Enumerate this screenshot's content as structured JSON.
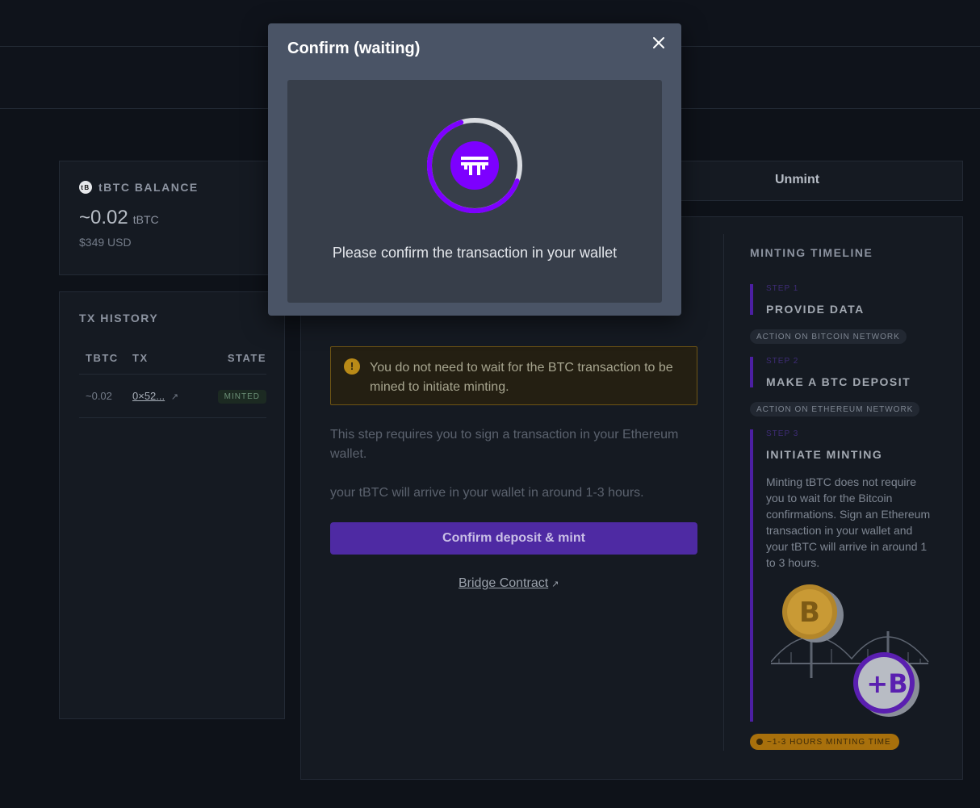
{
  "balance": {
    "title": "tBTC BALANCE",
    "token_icon": "tbtc-token-icon",
    "token_glyph": "tB",
    "amount": "~0.02",
    "unit": "tBTC",
    "usd": "$349 USD"
  },
  "history": {
    "title": "TX HISTORY",
    "columns": [
      "TBTC",
      "TX",
      "STATE"
    ],
    "rows": [
      {
        "amount": "~0.02",
        "tx": "0×52...",
        "state": "MINTED"
      }
    ]
  },
  "tabs": {
    "unmint": "Unmint"
  },
  "form": {
    "alert_icon": "!",
    "alert": "You do not need to wait for the BTC transaction to be mined to initiate minting.",
    "step_text": "This step requires you to sign a transaction in your Ethereum wallet.",
    "eta_text": "your tBTC will arrive in your wallet in around 1-3 hours.",
    "cta": "Confirm deposit & mint",
    "bridge_link": "Bridge Contract"
  },
  "timeline": {
    "title": "MINTING TIMELINE",
    "steps": [
      {
        "label": "STEP 1",
        "title": "PROVIDE DATA",
        "badge": "ACTION ON BITCOIN NETWORK"
      },
      {
        "label": "STEP 2",
        "title": "MAKE A BTC DEPOSIT",
        "badge": "ACTION ON ETHEREUM NETWORK"
      },
      {
        "label": "STEP 3",
        "title": "INITIATE MINTING",
        "description": "Minting tBTC does not require you to wait for the Bitcoin confirmations. Sign an Ethereum transaction in your wallet and your tBTC will arrive in around 1 to 3 hours."
      }
    ],
    "time_badge": "~1-3 HOURS MINTING TIME"
  },
  "modal": {
    "title": "Confirm (waiting)",
    "message": "Please confirm the transaction in your wallet",
    "icons": {
      "close": "close-icon",
      "spinner": "loading-spinner-icon",
      "logo": "threshold-logo-icon"
    }
  },
  "colors": {
    "modal_bg": "#4a5466",
    "modal_body": "#373e4a",
    "accent_purple": "#7d00ff",
    "cta_purple": "#4e2aa3",
    "warning_amber": "#b98a17"
  }
}
